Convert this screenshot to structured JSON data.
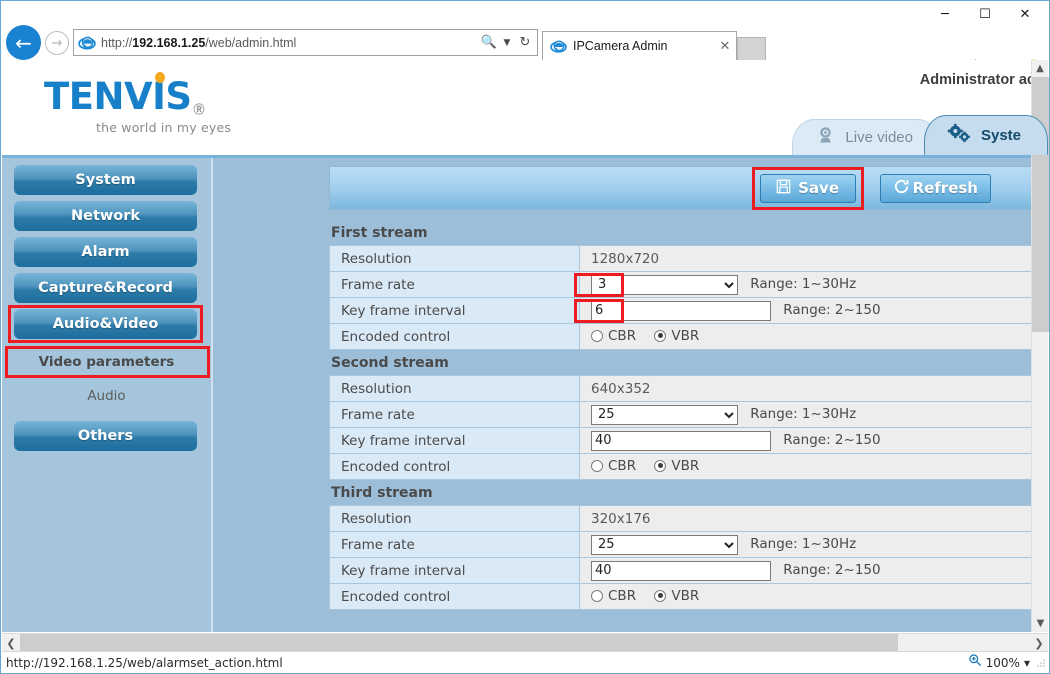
{
  "browser": {
    "url_prefix": "http://",
    "url_host": "192.168.1.25",
    "url_path": "/web/admin.html",
    "full_url": "http://192.168.1.25/web/admin.html",
    "back_icon": "back-arrow-icon",
    "forward_icon": "forward-arrow-icon",
    "search_icon": "search-icon",
    "refresh_icon": "refresh-icon",
    "tabs": [
      {
        "title": "IPCamera Admin",
        "close_label": "✕"
      }
    ],
    "new_tab_label": "",
    "command_icons": [
      "home-icon",
      "favorites-star-icon",
      "gear-icon",
      "smiley-icon"
    ],
    "window_controls": {
      "minimize": "─",
      "maximize": "☐",
      "close": "✕"
    }
  },
  "status": {
    "url": "http://192.168.1.25/web/alarmset_action.html",
    "zoom_level": "100%",
    "zoom_icon": "zoom-magnifier-icon",
    "dropdown_arrow": "▾"
  },
  "header": {
    "logo_text": "TENVIS",
    "logo_registered": "Ⓡ",
    "tagline": "the world in my eyes",
    "admin_text": "Administrator ac"
  },
  "nav_tabs": [
    {
      "label": "Live video",
      "icon": "camera-icon",
      "active": false
    },
    {
      "label": "Syste",
      "icon": "gears-icon",
      "active": true
    }
  ],
  "sidebar": {
    "items": [
      {
        "label": "System",
        "type": "button",
        "highlighted": false
      },
      {
        "label": "Network",
        "type": "button",
        "highlighted": false
      },
      {
        "label": "Alarm",
        "type": "button",
        "highlighted": false
      },
      {
        "label": "Capture&Record",
        "type": "button",
        "highlighted": false
      },
      {
        "label": "Audio&Video",
        "type": "button",
        "highlighted": true
      },
      {
        "label": "Video parameters",
        "type": "sub",
        "highlighted": true,
        "selected": true
      },
      {
        "label": "Audio",
        "type": "sub",
        "highlighted": false,
        "selected": false
      },
      {
        "label": "Others",
        "type": "button",
        "highlighted": false
      }
    ]
  },
  "toolbar": {
    "save_label": "Save",
    "save_icon": "floppy-disk-icon",
    "save_highlighted": true,
    "refresh_label": "Refresh",
    "refresh_icon": "circular-arrow-icon"
  },
  "streams": [
    {
      "title": "First stream",
      "resolution_label": "Resolution",
      "resolution_value": "1280x720",
      "frame_rate_label": "Frame rate",
      "frame_rate_value": "3",
      "frame_rate_range": "Range: 1~30Hz",
      "frame_rate_highlighted": true,
      "key_frame_label": "Key frame interval",
      "key_frame_value": "6",
      "key_frame_range": "Range: 2~150",
      "key_frame_highlighted": true,
      "encoded_label": "Encoded control",
      "cbr_label": "CBR",
      "vbr_label": "VBR",
      "selected_encoding": "VBR"
    },
    {
      "title": "Second stream",
      "resolution_label": "Resolution",
      "resolution_value": "640x352",
      "frame_rate_label": "Frame rate",
      "frame_rate_value": "25",
      "frame_rate_range": "Range: 1~30Hz",
      "frame_rate_highlighted": false,
      "key_frame_label": "Key frame interval",
      "key_frame_value": "40",
      "key_frame_range": "Range: 2~150",
      "key_frame_highlighted": false,
      "encoded_label": "Encoded control",
      "cbr_label": "CBR",
      "vbr_label": "VBR",
      "selected_encoding": "VBR"
    },
    {
      "title": "Third stream",
      "resolution_label": "Resolution",
      "resolution_value": "320x176",
      "frame_rate_label": "Frame rate",
      "frame_rate_value": "25",
      "frame_rate_range": "Range: 1~30Hz",
      "frame_rate_highlighted": false,
      "key_frame_label": "Key frame interval",
      "key_frame_value": "40",
      "key_frame_range": "Range: 2~150",
      "key_frame_highlighted": false,
      "encoded_label": "Encoded control",
      "cbr_label": "CBR",
      "vbr_label": "VBR",
      "selected_encoding": "VBR"
    }
  ],
  "colors": {
    "highlight_red": "#ee1c22",
    "brand_blue": "#1780c8",
    "brand_orange": "#f5a81c",
    "content_bg": "#9dbed8",
    "sidebar_bg": "#a5c5dc",
    "label_cell": "#d9e9f6",
    "value_cell": "#ededed"
  }
}
